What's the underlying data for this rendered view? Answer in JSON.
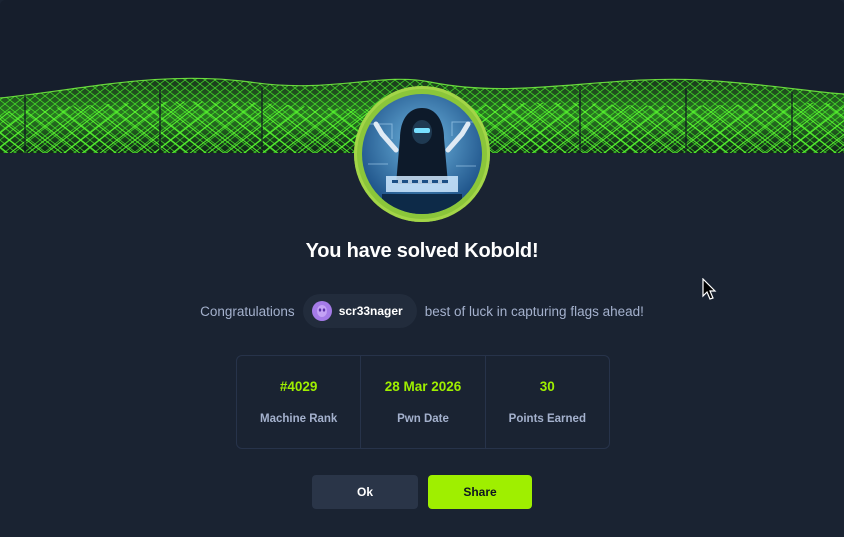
{
  "modal": {
    "title": "You have solved Kobold!",
    "congrats_prefix": "Congratulations",
    "username": "scr33nager",
    "congrats_suffix": "best of luck in capturing flags ahead!"
  },
  "stats": [
    {
      "value": "#4029",
      "label": "Machine Rank"
    },
    {
      "value": "28 Mar 2026",
      "label": "Pwn Date"
    },
    {
      "value": "30",
      "label": "Points Earned"
    }
  ],
  "buttons": {
    "ok_label": "Ok",
    "share_label": "Share"
  },
  "colors": {
    "accent": "#9fef00",
    "background": "#1a2332",
    "user_avatar": "#a57be8"
  },
  "icons": {
    "banner": "green-cyber-wave-banner",
    "machine_avatar": "hooded-hacker-avatar",
    "user_avatar": "alien-avatar-icon",
    "cursor": "mouse-pointer-icon"
  }
}
